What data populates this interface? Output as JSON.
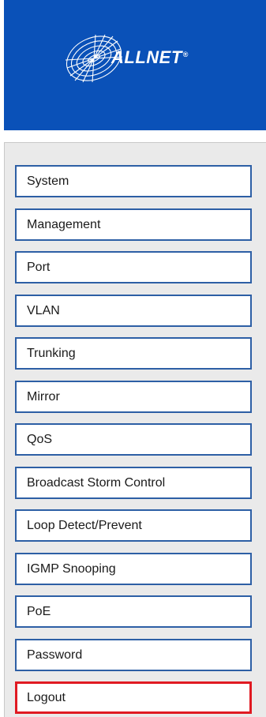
{
  "header": {
    "brand": "ALLNET",
    "registered_mark": "®",
    "logo_icon": "allnet-globe-logo-icon",
    "background_color": "#0a51b8"
  },
  "menu": {
    "items": [
      {
        "label": "System"
      },
      {
        "label": "Management"
      },
      {
        "label": "Port"
      },
      {
        "label": "VLAN"
      },
      {
        "label": "Trunking"
      },
      {
        "label": "Mirror"
      },
      {
        "label": "QoS"
      },
      {
        "label": "Broadcast Storm Control"
      },
      {
        "label": "Loop Detect/Prevent"
      },
      {
        "label": "IGMP Snooping"
      },
      {
        "label": "PoE"
      },
      {
        "label": "Password"
      },
      {
        "label": "Logout"
      }
    ],
    "selected_label": "Logout",
    "item_border_color": "#2d5fa5",
    "selected_border_color": "#e01a22"
  }
}
